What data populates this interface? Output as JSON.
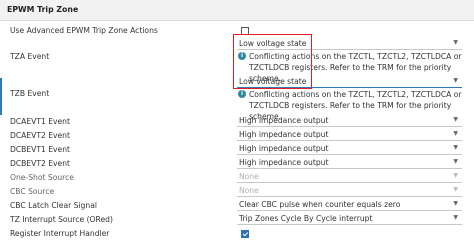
{
  "section": {
    "title": "EPWM Trip Zone"
  },
  "rows": {
    "use_advanced": {
      "label": "Use Advanced EPWM Trip Zone Actions",
      "checked": false
    },
    "tza_event": {
      "label": "TZA Event",
      "value": "Low voltage state",
      "info": "Conflicting actions on the TZCTL, TZCTL2, TZCTLDCA or TZCTLDCB registers. Refer to the TRM for the priority scheme."
    },
    "tzb_event": {
      "label": "TZB Event",
      "value": "Low voltage state",
      "info": "Conflicting actions on the TZCTL, TZCTL2, TZCTLDCA or TZCTLDCB registers. Refer to the TRM for the priority scheme."
    },
    "dcaevt1": {
      "label": "DCAEVT1 Event",
      "value": "High impedance output"
    },
    "dcaevt2": {
      "label": "DCAEVT2 Event",
      "value": "High impedance output"
    },
    "dcbevt1": {
      "label": "DCBEVT1 Event",
      "value": "High impedance output"
    },
    "dcbevt2": {
      "label": "DCBEVT2 Event",
      "value": "High impedance output"
    },
    "one_shot": {
      "label": "One-Shot Source",
      "value": "None"
    },
    "cbc": {
      "label": "CBC Source",
      "value": "None"
    },
    "cbc_latch": {
      "label": "CBC Latch Clear Signal",
      "value": "Clear CBC pulse when counter equals zero"
    },
    "tz_interrupt": {
      "label": "TZ Interrupt Source (ORed)",
      "value": "Trip Zones Cycle By Cycle interrupt"
    },
    "register_interrupt": {
      "label": "Register Interrupt Handler",
      "checked": true
    }
  },
  "icons": {
    "info": "info-icon",
    "caret": "chevron-down-icon"
  },
  "glyphs": {
    "info": "i",
    "caret": "▼"
  },
  "colors": {
    "accent": "#2d7bb6",
    "highlight_box": "#e02020",
    "checkbox_checked": "#2f6eb5",
    "info_icon": "#2d8a9a"
  }
}
